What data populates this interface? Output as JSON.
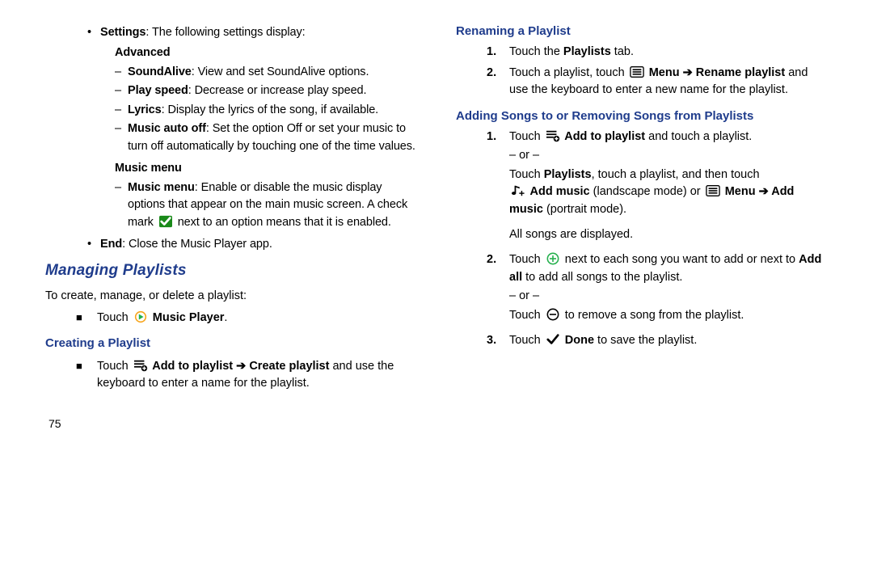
{
  "left": {
    "settings_intro_bold": "Settings",
    "settings_intro_rest": ": The following settings display:",
    "advanced_heading": "Advanced",
    "adv": [
      {
        "bold": "SoundAlive",
        "rest": ": View and set SoundAlive options."
      },
      {
        "bold": "Play speed",
        "rest": ": Decrease or increase play speed."
      },
      {
        "bold": "Lyrics",
        "rest": ": Display the lyrics of the song, if available."
      },
      {
        "bold": "Music auto off",
        "rest": ": Set the option Off or set your music to turn off automatically by touching one of the time values."
      }
    ],
    "musicmenu_heading": "Music menu",
    "musicmenu_bold": "Music menu",
    "musicmenu_rest_a": ": Enable or disable the music display options that appear on the main music screen. A check mark ",
    "musicmenu_rest_b": " next to an option means that it is enabled.",
    "end_bold": "End",
    "end_rest": ": Close the Music Player app.",
    "managing_h": "Managing Playlists",
    "managing_intro": "To create, manage, or delete a playlist:",
    "touch": "Touch ",
    "music_player_bold": " Music Player",
    "period": ".",
    "creating_h": "Creating a Playlist",
    "create_line_a": "Touch ",
    "create_line_bold": "  Add to playlist ➔ Create playlist",
    "create_line_b": " and use the keyboard to enter a name for the playlist.",
    "page_number": "75"
  },
  "right": {
    "renaming_h": "Renaming a Playlist",
    "r1_a": "Touch the ",
    "r1_bold": "Playlists",
    "r1_b": " tab.",
    "r2_a": "Touch a playlist, touch ",
    "r2_bold1": "  Menu ➔ Rename playlist",
    "r2_b": " and use the keyboard to enter a new name for the playlist.",
    "adding_h": "Adding Songs to or Removing Songs from Playlists",
    "a1_a": "Touch ",
    "a1_bold": "  Add to playlist",
    "a1_b": " and touch a playlist.",
    "or_text": "– or –",
    "a1c_a": "Touch ",
    "a1c_bold1": "Playlists",
    "a1c_b": ", touch a playlist, and then touch ",
    "a1c_bold2": "  Add music",
    "a1c_c": " (landscape mode) or ",
    "a1c_bold3": "  Menu ➔ Add music",
    "a1c_d": " (portrait mode).",
    "a1d": "All songs are displayed.",
    "a2_a": "Touch ",
    "a2_b": " next to each song you want to add or next to ",
    "a2_bold": "Add all",
    "a2_c": " to add all songs to the playlist.",
    "a2r_a": "Touch ",
    "a2r_b": " to remove a song from the playlist.",
    "a3_a": "Touch ",
    "a3_bold": "  Done",
    "a3_b": " to save the playlist."
  }
}
